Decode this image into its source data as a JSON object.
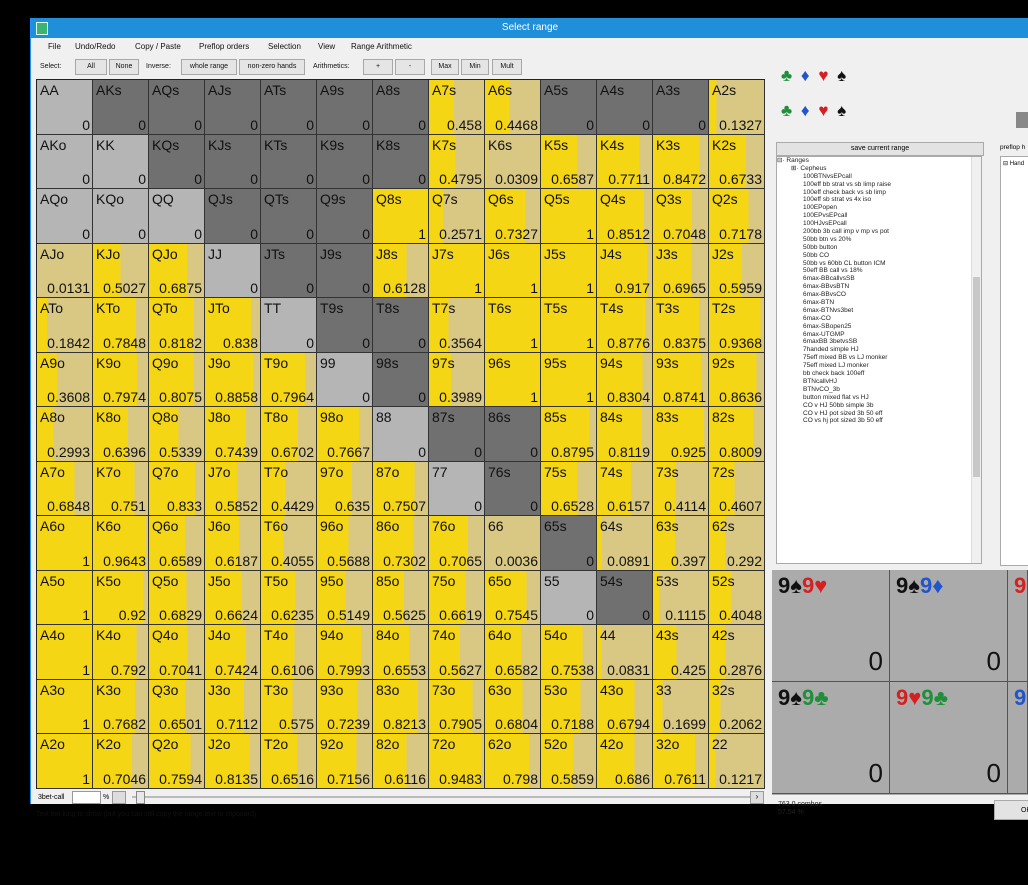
{
  "window": {
    "title": "Select range"
  },
  "menu": [
    "File",
    "Undo/Redo",
    "Copy / Paste",
    "Preflop orders",
    "Selection",
    "View",
    "Range Arithmetic"
  ],
  "toolbar": {
    "select_label": "Select:",
    "all": "All",
    "none": "None",
    "inverse_label": "Inverse:",
    "whole_range": "whole range",
    "non_zero": "non-zero hands",
    "arith_label": "Arithmetics:",
    "plus": "+",
    "minus": "-",
    "max": "Max",
    "min": "Min",
    "mult": "Mult"
  },
  "colors": {
    "selected": "#f5d615",
    "light": "#b5b5b5",
    "dark": "#707070"
  },
  "grid": [
    [
      {
        "h": "AA",
        "v": "0"
      },
      {
        "h": "AKs",
        "v": "0"
      },
      {
        "h": "AQs",
        "v": "0"
      },
      {
        "h": "AJs",
        "v": "0"
      },
      {
        "h": "ATs",
        "v": "0"
      },
      {
        "h": "A9s",
        "v": "0"
      },
      {
        "h": "A8s",
        "v": "0"
      },
      {
        "h": "A7s",
        "v": "0.458"
      },
      {
        "h": "A6s",
        "v": "0.4468"
      },
      {
        "h": "A5s",
        "v": "0"
      },
      {
        "h": "A4s",
        "v": "0"
      },
      {
        "h": "A3s",
        "v": "0"
      },
      {
        "h": "A2s",
        "v": "0.1327"
      }
    ],
    [
      {
        "h": "AKo",
        "v": "0"
      },
      {
        "h": "KK",
        "v": "0"
      },
      {
        "h": "KQs",
        "v": "0"
      },
      {
        "h": "KJs",
        "v": "0"
      },
      {
        "h": "KTs",
        "v": "0"
      },
      {
        "h": "K9s",
        "v": "0"
      },
      {
        "h": "K8s",
        "v": "0"
      },
      {
        "h": "K7s",
        "v": "0.4795"
      },
      {
        "h": "K6s",
        "v": "0.0309"
      },
      {
        "h": "K5s",
        "v": "0.6587"
      },
      {
        "h": "K4s",
        "v": "0.7711"
      },
      {
        "h": "K3s",
        "v": "0.8472"
      },
      {
        "h": "K2s",
        "v": "0.6733"
      }
    ],
    [
      {
        "h": "AQo",
        "v": "0"
      },
      {
        "h": "KQo",
        "v": "0"
      },
      {
        "h": "QQ",
        "v": "0"
      },
      {
        "h": "QJs",
        "v": "0"
      },
      {
        "h": "QTs",
        "v": "0"
      },
      {
        "h": "Q9s",
        "v": "0"
      },
      {
        "h": "Q8s",
        "v": "1"
      },
      {
        "h": "Q7s",
        "v": "0.2571"
      },
      {
        "h": "Q6s",
        "v": "0.7327"
      },
      {
        "h": "Q5s",
        "v": "1"
      },
      {
        "h": "Q4s",
        "v": "0.8512"
      },
      {
        "h": "Q3s",
        "v": "0.7048"
      },
      {
        "h": "Q2s",
        "v": "0.7178"
      }
    ],
    [
      {
        "h": "AJo",
        "v": "0.0131"
      },
      {
        "h": "KJo",
        "v": "0.5027"
      },
      {
        "h": "QJo",
        "v": "0.6875"
      },
      {
        "h": "JJ",
        "v": "0"
      },
      {
        "h": "JTs",
        "v": "0"
      },
      {
        "h": "J9s",
        "v": "0"
      },
      {
        "h": "J8s",
        "v": "0.6128"
      },
      {
        "h": "J7s",
        "v": "1"
      },
      {
        "h": "J6s",
        "v": "1"
      },
      {
        "h": "J5s",
        "v": "1"
      },
      {
        "h": "J4s",
        "v": "0.917"
      },
      {
        "h": "J3s",
        "v": "0.6965"
      },
      {
        "h": "J2s",
        "v": "0.5959"
      }
    ],
    [
      {
        "h": "ATo",
        "v": "0.1842"
      },
      {
        "h": "KTo",
        "v": "0.7848"
      },
      {
        "h": "QTo",
        "v": "0.8182"
      },
      {
        "h": "JTo",
        "v": "0.838"
      },
      {
        "h": "TT",
        "v": "0"
      },
      {
        "h": "T9s",
        "v": "0"
      },
      {
        "h": "T8s",
        "v": "0"
      },
      {
        "h": "T7s",
        "v": "0.3564"
      },
      {
        "h": "T6s",
        "v": "1"
      },
      {
        "h": "T5s",
        "v": "1"
      },
      {
        "h": "T4s",
        "v": "0.8776"
      },
      {
        "h": "T3s",
        "v": "0.8375"
      },
      {
        "h": "T2s",
        "v": "0.9368"
      }
    ],
    [
      {
        "h": "A9o",
        "v": "0.3608"
      },
      {
        "h": "K9o",
        "v": "0.7974"
      },
      {
        "h": "Q9o",
        "v": "0.8075"
      },
      {
        "h": "J9o",
        "v": "0.8858"
      },
      {
        "h": "T9o",
        "v": "0.7964"
      },
      {
        "h": "99",
        "v": "0"
      },
      {
        "h": "98s",
        "v": "0"
      },
      {
        "h": "97s",
        "v": "0.3989"
      },
      {
        "h": "96s",
        "v": "1"
      },
      {
        "h": "95s",
        "v": "1"
      },
      {
        "h": "94s",
        "v": "0.8304"
      },
      {
        "h": "93s",
        "v": "0.8741"
      },
      {
        "h": "92s",
        "v": "0.8636"
      }
    ],
    [
      {
        "h": "A8o",
        "v": "0.2993"
      },
      {
        "h": "K8o",
        "v": "0.6396"
      },
      {
        "h": "Q8o",
        "v": "0.5339"
      },
      {
        "h": "J8o",
        "v": "0.7439"
      },
      {
        "h": "T8o",
        "v": "0.6702"
      },
      {
        "h": "98o",
        "v": "0.7667"
      },
      {
        "h": "88",
        "v": "0"
      },
      {
        "h": "87s",
        "v": "0"
      },
      {
        "h": "86s",
        "v": "0"
      },
      {
        "h": "85s",
        "v": "0.8795"
      },
      {
        "h": "84s",
        "v": "0.8119"
      },
      {
        "h": "83s",
        "v": "0.925"
      },
      {
        "h": "82s",
        "v": "0.8009"
      }
    ],
    [
      {
        "h": "A7o",
        "v": "0.6848"
      },
      {
        "h": "K7o",
        "v": "0.751"
      },
      {
        "h": "Q7o",
        "v": "0.833"
      },
      {
        "h": "J7o",
        "v": "0.5852"
      },
      {
        "h": "T7o",
        "v": "0.4429"
      },
      {
        "h": "97o",
        "v": "0.635"
      },
      {
        "h": "87o",
        "v": "0.7507"
      },
      {
        "h": "77",
        "v": "0"
      },
      {
        "h": "76s",
        "v": "0"
      },
      {
        "h": "75s",
        "v": "0.6528"
      },
      {
        "h": "74s",
        "v": "0.6157"
      },
      {
        "h": "73s",
        "v": "0.4114"
      },
      {
        "h": "72s",
        "v": "0.4607"
      }
    ],
    [
      {
        "h": "A6o",
        "v": "1"
      },
      {
        "h": "K6o",
        "v": "0.9643"
      },
      {
        "h": "Q6o",
        "v": "0.6589"
      },
      {
        "h": "J6o",
        "v": "0.6187"
      },
      {
        "h": "T6o",
        "v": "0.4055"
      },
      {
        "h": "96o",
        "v": "0.5688"
      },
      {
        "h": "86o",
        "v": "0.7302"
      },
      {
        "h": "76o",
        "v": "0.7065"
      },
      {
        "h": "66",
        "v": "0.0036"
      },
      {
        "h": "65s",
        "v": "0"
      },
      {
        "h": "64s",
        "v": "0.0891"
      },
      {
        "h": "63s",
        "v": "0.397"
      },
      {
        "h": "62s",
        "v": "0.292"
      }
    ],
    [
      {
        "h": "A5o",
        "v": "1"
      },
      {
        "h": "K5o",
        "v": "0.92"
      },
      {
        "h": "Q5o",
        "v": "0.6829"
      },
      {
        "h": "J5o",
        "v": "0.6624"
      },
      {
        "h": "T5o",
        "v": "0.6235"
      },
      {
        "h": "95o",
        "v": "0.5149"
      },
      {
        "h": "85o",
        "v": "0.5625"
      },
      {
        "h": "75o",
        "v": "0.6619"
      },
      {
        "h": "65o",
        "v": "0.7545"
      },
      {
        "h": "55",
        "v": "0"
      },
      {
        "h": "54s",
        "v": "0"
      },
      {
        "h": "53s",
        "v": "0.1115"
      },
      {
        "h": "52s",
        "v": "0.4048"
      }
    ],
    [
      {
        "h": "A4o",
        "v": "1"
      },
      {
        "h": "K4o",
        "v": "0.792"
      },
      {
        "h": "Q4o",
        "v": "0.7041"
      },
      {
        "h": "J4o",
        "v": "0.7424"
      },
      {
        "h": "T4o",
        "v": "0.6106"
      },
      {
        "h": "94o",
        "v": "0.7993"
      },
      {
        "h": "84o",
        "v": "0.6553"
      },
      {
        "h": "74o",
        "v": "0.5627"
      },
      {
        "h": "64o",
        "v": "0.6582"
      },
      {
        "h": "54o",
        "v": "0.7538"
      },
      {
        "h": "44",
        "v": "0.0831"
      },
      {
        "h": "43s",
        "v": "0.425"
      },
      {
        "h": "42s",
        "v": "0.2876"
      }
    ],
    [
      {
        "h": "A3o",
        "v": "1"
      },
      {
        "h": "K3o",
        "v": "0.7682"
      },
      {
        "h": "Q3o",
        "v": "0.6501"
      },
      {
        "h": "J3o",
        "v": "0.7112"
      },
      {
        "h": "T3o",
        "v": "0.575"
      },
      {
        "h": "93o",
        "v": "0.7239"
      },
      {
        "h": "83o",
        "v": "0.8213"
      },
      {
        "h": "73o",
        "v": "0.7905"
      },
      {
        "h": "63o",
        "v": "0.6804"
      },
      {
        "h": "53o",
        "v": "0.7188"
      },
      {
        "h": "43o",
        "v": "0.6794"
      },
      {
        "h": "33",
        "v": "0.1699"
      },
      {
        "h": "32s",
        "v": "0.2062"
      }
    ],
    [
      {
        "h": "A2o",
        "v": "1"
      },
      {
        "h": "K2o",
        "v": "0.7046"
      },
      {
        "h": "Q2o",
        "v": "0.7594"
      },
      {
        "h": "J2o",
        "v": "0.8135"
      },
      {
        "h": "T2o",
        "v": "0.6516"
      },
      {
        "h": "92o",
        "v": "0.7156"
      },
      {
        "h": "82o",
        "v": "0.6116"
      },
      {
        "h": "72o",
        "v": "0.9483"
      },
      {
        "h": "62o",
        "v": "0.798"
      },
      {
        "h": "52o",
        "v": "0.5859"
      },
      {
        "h": "42o",
        "v": "0.686"
      },
      {
        "h": "32o",
        "v": "0.7611"
      },
      {
        "h": "22",
        "v": "0.1217"
      }
    ]
  ],
  "slider": {
    "label": "3bet-call",
    "unit": "%"
  },
  "status_text": "Text too long to show (but you can still copy the range text to clipboard)",
  "right_panel": {
    "save_button": "save current range",
    "tree_header_right": "preflop h",
    "tree_root": "Ranges",
    "tree_child": "Cepheus",
    "tree_items": [
      "100BTNvsEPcall",
      "100eff bb strat vs sb limp raise",
      "100eff check back vs sb limp",
      "100eff sb strat vs 4x iso",
      "100EPopen",
      "100EPvsEPcall",
      "100HJvsEPcall",
      "200bb 3b call imp v mp vs pot",
      "50bb btn vs 20%",
      "50bb button",
      "50bb CO",
      "50bb vs 60bb CL button ICM",
      "50eff BB call vs 18%",
      "6max-BBcallvsSB",
      "6max-BBvsBTN",
      "6max-BBvsCO",
      "6max-BTN",
      "6max-BTNvs3bet",
      "6max-CO",
      "6max-SBopen25",
      "6max-UTGMP",
      "6maxBB 3betvsSB",
      "7handed simple HJ",
      "75eff mixed BB vs LJ monker",
      "75eff mixed LJ monker",
      "bb check back 100eff",
      "BTNcallvHJ",
      "BTNvCO_3b",
      "button mixed flat vs HJ",
      "CO v HJ 50bb simple 3b",
      "CO v HJ pot sized 3b 50 eff",
      "CO vs hj pot sized 3b 50 eff"
    ],
    "tree2_item": "Hand",
    "suit_rows": [
      "♣",
      "♦",
      "♥",
      "♠"
    ]
  },
  "cards": [
    {
      "rank1": "9",
      "suit1": "♠",
      "rank2": "9",
      "suit2": "♥",
      "c1": "blk",
      "c2": "red",
      "value": "0"
    },
    {
      "rank1": "9",
      "suit1": "♠",
      "rank2": "9",
      "suit2": "♦",
      "c1": "blk",
      "c2": "blu",
      "value": "0"
    },
    {
      "rank1": "9",
      "suit1": "♠",
      "rank2": "9",
      "suit2": "♣",
      "c1": "blk",
      "c2": "grn",
      "value": "0"
    },
    {
      "rank1": "9",
      "suit1": "♥",
      "rank2": "9",
      "suit2": "♣",
      "c1": "red",
      "c2": "grn",
      "value": "0"
    }
  ],
  "partial_card_rank": "9",
  "combos": {
    "count": "763.0 combos",
    "percent": "57.54 %"
  },
  "ok_label": "OK"
}
